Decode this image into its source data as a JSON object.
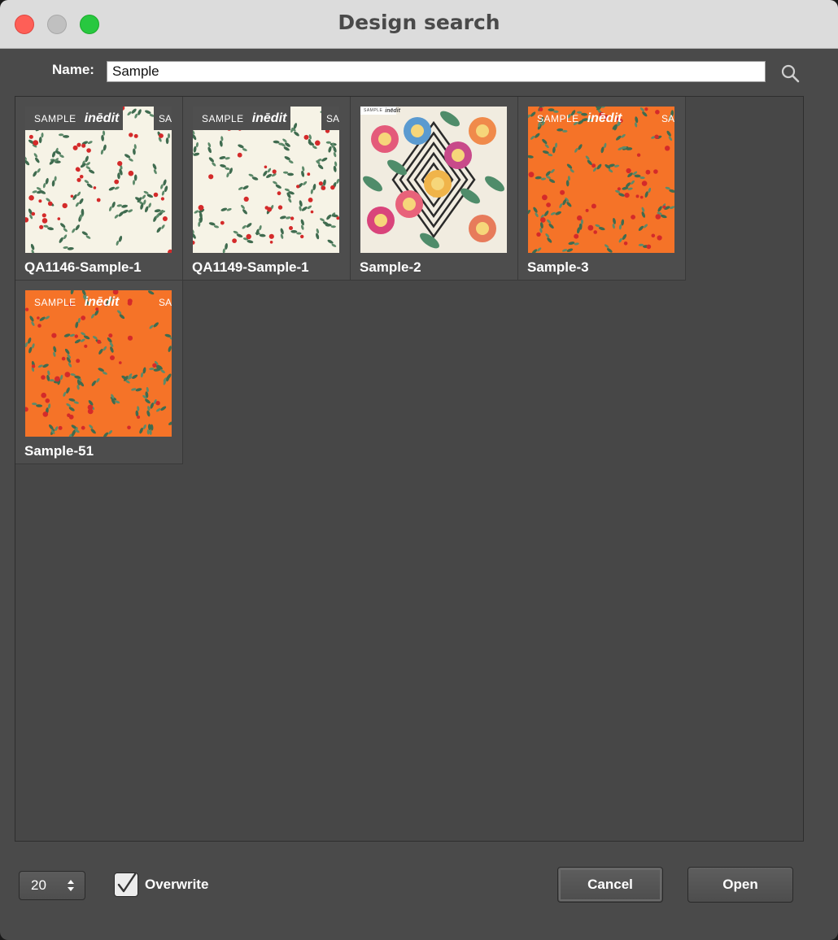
{
  "window": {
    "title": "Design search"
  },
  "search": {
    "label": "Name:",
    "value": "Sample",
    "icon": "magnifier-icon"
  },
  "results": [
    {
      "name": "QA1146-Sample-1",
      "pattern": "cream-floral",
      "watermark": "SAMPLE",
      "brand": "inēdit",
      "watermark_right": "SA"
    },
    {
      "name": "QA1149-Sample-1",
      "pattern": "cream-floral",
      "watermark": "SAMPLE",
      "brand": "inēdit",
      "watermark_right": "SA"
    },
    {
      "name": "Sample-2",
      "pattern": "floral-diamond",
      "watermark": "SAMPLE",
      "brand": "inēdit",
      "watermark_right": ""
    },
    {
      "name": "Sample-3",
      "pattern": "orange-floral",
      "watermark": "SAMPLE",
      "brand": "inēdit",
      "watermark_right": "SA"
    },
    {
      "name": "Sample-51",
      "pattern": "orange-floral",
      "watermark": "SAMPLE",
      "brand": "inēdit",
      "watermark_right": "SA"
    }
  ],
  "footer": {
    "page_size": "20",
    "overwrite_label": "Overwrite",
    "overwrite_checked": true,
    "cancel_label": "Cancel",
    "open_label": "Open"
  },
  "colors": {
    "cream_bg": "#f6f3e6",
    "orange_bg": "#f57328",
    "leaf": "#3f6b4f",
    "flower_red": "#d42a2a"
  }
}
